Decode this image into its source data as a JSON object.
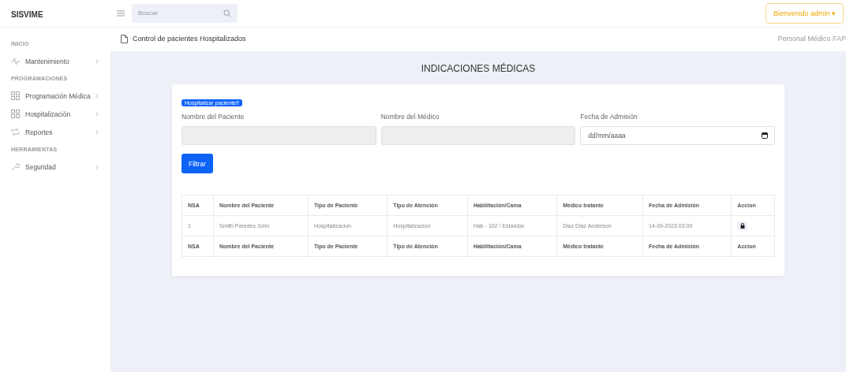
{
  "app": {
    "brand": "SISVIME"
  },
  "search": {
    "placeholder": "Buscar"
  },
  "user_menu": {
    "label": "Bienvenido admin",
    "caret": "▾"
  },
  "sidebar": {
    "sections": [
      {
        "title": "INICIO",
        "items": [
          {
            "label": "Mantenimiento",
            "kind": "pulse"
          }
        ]
      },
      {
        "title": "PROGRAMACIONES",
        "items": [
          {
            "label": "Programación Médica",
            "kind": "grid"
          },
          {
            "label": "Hospitalización",
            "kind": "grid"
          },
          {
            "label": "Reportes",
            "kind": "repeat"
          }
        ]
      },
      {
        "title": "HERRAMIENTAS",
        "items": [
          {
            "label": "Seguridad",
            "kind": "wrench"
          }
        ]
      }
    ]
  },
  "breadcrumb": {
    "title": "Control de pacientes Hospitalizados",
    "right": "Personal Médico FAP"
  },
  "page_title": "INDICACIONES MÉDICAS",
  "form": {
    "badge": "Hospitalizar paciente!!",
    "fields": [
      {
        "label": "Nombre del Paciente",
        "kind": "text",
        "disabled": true
      },
      {
        "label": "Nombre del Médico",
        "kind": "text",
        "disabled": true
      },
      {
        "label": "Fecha de Admisión",
        "kind": "date",
        "placeholder": "dd/mm/aaaa",
        "disabled": false
      }
    ],
    "button": "Filtrar"
  },
  "table": {
    "columns": [
      "NSA",
      "Nombre del Paciente",
      "Tipo de Paciente",
      "Tipo de Atención",
      "Habilitación/Cama",
      "Médico tratante",
      "Fecha de Admisión",
      "Accion"
    ],
    "rows": [
      [
        "1",
        "Smith Paredes John",
        "Hospitalizacion",
        "Hospitalizacion",
        "Hab - 102 / Estandar",
        "Diaz Diaz Anderson",
        "14-09-2023 03:00"
      ]
    ],
    "footer": [
      "NSA",
      "Nombre del Paciente",
      "Tipo de Paciente",
      "Tipo de Atención",
      "Habilitación/Cama",
      "Médico tratante",
      "Fecha de Admisión",
      "Accion"
    ]
  }
}
